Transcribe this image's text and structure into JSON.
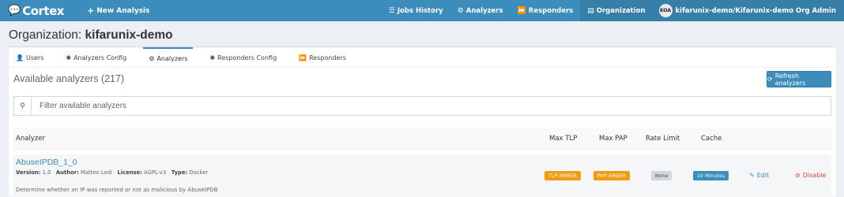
{
  "navbar": {
    "logo_text": "Cortex",
    "new_analysis": "New Analysis",
    "items": [
      {
        "label": "Jobs History",
        "icon": "tasks-icon"
      },
      {
        "label": "Analyzers",
        "icon": "cogs-icon"
      },
      {
        "label": "Responders",
        "icon": "fast-forward-icon"
      },
      {
        "label": "Organization",
        "icon": "file-icon"
      }
    ],
    "user": {
      "initials": "KOA",
      "label": "kifarunix-demo/Kifarunix-demo Org Admin"
    },
    "color": "#3c8dbc"
  },
  "page": {
    "title_prefix": "Organization:",
    "title_org": "kifarunix-demo"
  },
  "tabs": [
    {
      "label": "Users",
      "icon": "user-icon"
    },
    {
      "label": "Analyzers Config",
      "icon": "cog-icon"
    },
    {
      "label": "Analyzers",
      "icon": "cogs-icon",
      "active": true
    },
    {
      "label": "Responders Config",
      "icon": "cog-icon"
    },
    {
      "label": "Responders",
      "icon": "fast-forward-icon"
    }
  ],
  "section": {
    "title": "Available analyzers (217)",
    "refresh_label": "Refresh analyzers"
  },
  "search": {
    "placeholder": "Filter available analyzers"
  },
  "table": {
    "headers": {
      "analyzer": "Analyzer",
      "max_tlp": "Max TLP",
      "max_pap": "Max PAP",
      "rate_limit": "Rate Limit",
      "cache": "Cache"
    },
    "rows": [
      {
        "name": "AbuseIPDB_1_0",
        "version_label": "Version:",
        "version": "1.0",
        "author_label": "Author:",
        "author": "Matteo Lodi",
        "license_label": "License:",
        "license": "AGPL-v3",
        "type_label": "Type:",
        "type": "Docker",
        "description": "Determine whether an IP was reported or not as malicious by AbuseIPDB",
        "tlp": "TLP:AMBER",
        "pap": "PAP:AMBER",
        "rate_limit": "None",
        "cache": "10 Minutes",
        "edit": "Edit",
        "disable": "Disable"
      }
    ]
  }
}
